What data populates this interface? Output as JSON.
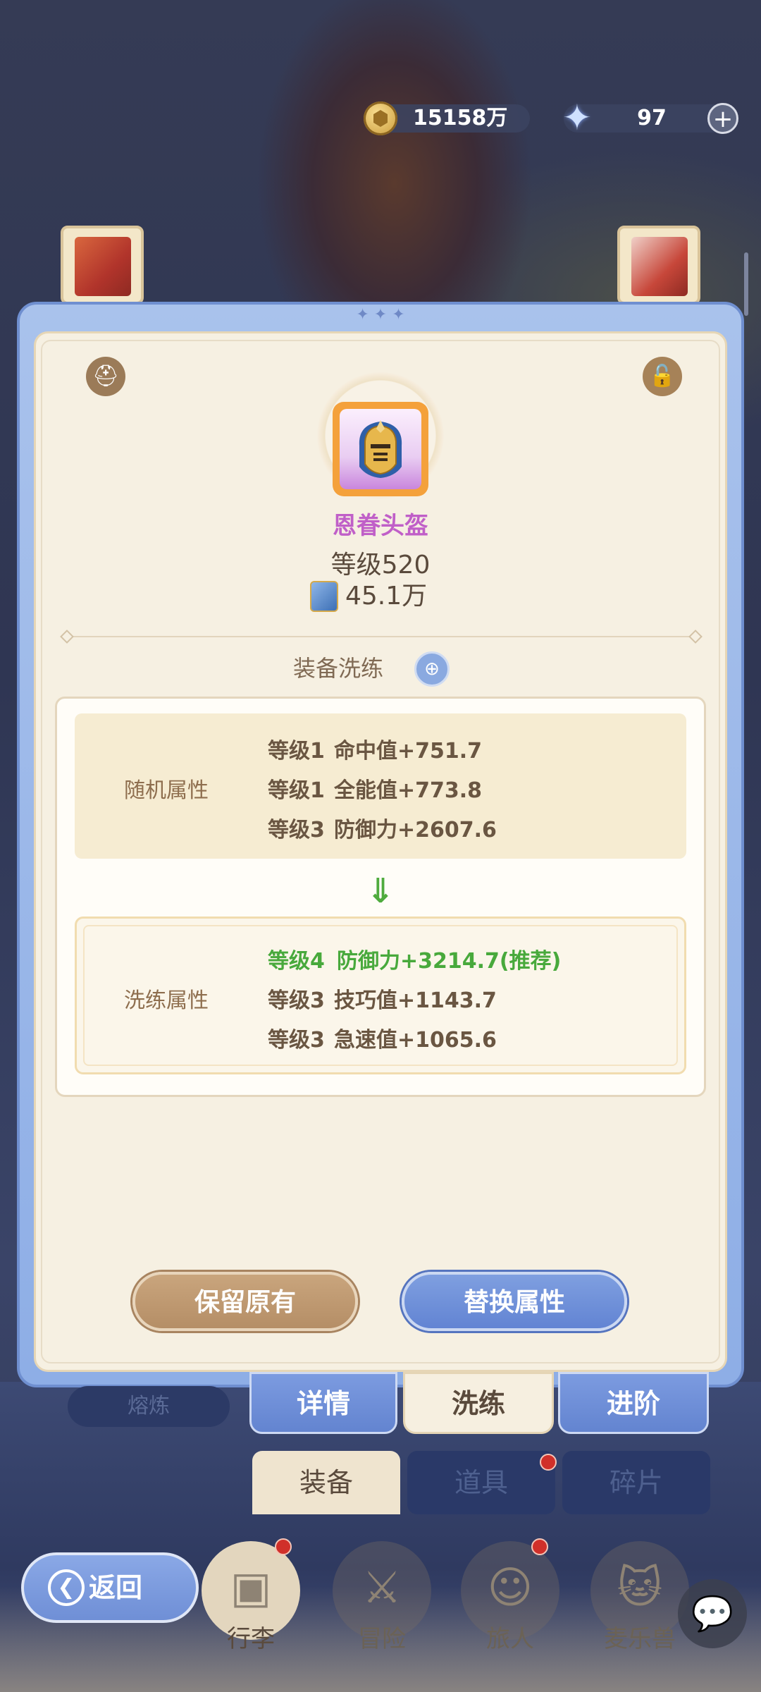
{
  "currency": {
    "gold": "15158万",
    "gems": "97",
    "gold_icon": "gold-coin-icon",
    "gem_icon": "crystal-star-icon",
    "add_icon": "plus-icon"
  },
  "item": {
    "name": "恩眷头盔",
    "level": "等级520",
    "power": "45.1万",
    "name_color": "#c05fc8",
    "frame_color": "#f4a13b"
  },
  "refine": {
    "section_title": "装备洗练",
    "random_label": "随机属性",
    "random_attrs": [
      {
        "level": "等级1",
        "text": "命中值+751.7"
      },
      {
        "level": "等级1",
        "text": "全能值+773.8"
      },
      {
        "level": "等级3",
        "text": "防御力+2607.6"
      }
    ],
    "refine_label": "洗练属性",
    "refine_attrs": [
      {
        "level": "等级4",
        "text": "防御力+3214.7(推荐)",
        "recommended": true
      },
      {
        "level": "等级3",
        "text": "技巧值+1143.7",
        "recommended": false
      },
      {
        "level": "等级3",
        "text": "急速值+1065.6",
        "recommended": false
      }
    ],
    "recommend_color": "#48a93c"
  },
  "actions": {
    "keep": "保留原有",
    "replace": "替换属性"
  },
  "detail_tabs": [
    "详情",
    "洗练",
    "进阶"
  ],
  "melt": "熔炼",
  "category_tabs": [
    "装备",
    "道具",
    "碎片"
  ],
  "bottom_nav": [
    "行李",
    "冒险",
    "旅人",
    "麦乐兽"
  ],
  "back": "返回"
}
